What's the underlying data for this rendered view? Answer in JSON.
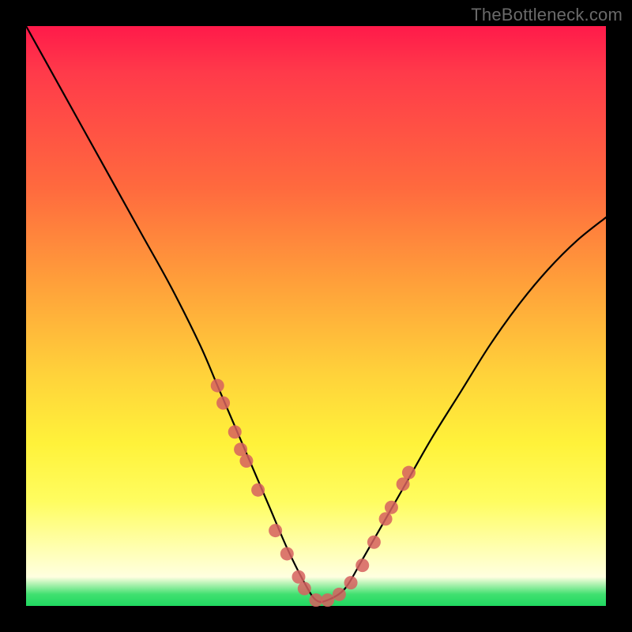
{
  "watermark": "TheBottleneck.com",
  "chart_data": {
    "type": "line",
    "title": "",
    "xlabel": "",
    "ylabel": "",
    "ylim": [
      0,
      100
    ],
    "xlim": [
      0,
      100
    ],
    "series": [
      {
        "name": "bottleneck-curve",
        "x": [
          0,
          5,
          10,
          15,
          20,
          25,
          30,
          33,
          36,
          39,
          42,
          45,
          48,
          50,
          52,
          55,
          58,
          62,
          66,
          70,
          75,
          80,
          85,
          90,
          95,
          100
        ],
        "values": [
          100,
          91,
          82,
          73,
          64,
          55,
          45,
          38,
          31,
          24,
          17,
          10,
          4,
          1,
          1,
          3,
          8,
          15,
          22,
          29,
          37,
          45,
          52,
          58,
          63,
          67
        ]
      }
    ],
    "markers": {
      "name": "highlight-points",
      "color": "#d6605f",
      "points": [
        {
          "x": 33,
          "y": 38
        },
        {
          "x": 34,
          "y": 35
        },
        {
          "x": 36,
          "y": 30
        },
        {
          "x": 37,
          "y": 27
        },
        {
          "x": 38,
          "y": 25
        },
        {
          "x": 40,
          "y": 20
        },
        {
          "x": 43,
          "y": 13
        },
        {
          "x": 45,
          "y": 9
        },
        {
          "x": 47,
          "y": 5
        },
        {
          "x": 48,
          "y": 3
        },
        {
          "x": 50,
          "y": 1
        },
        {
          "x": 52,
          "y": 1
        },
        {
          "x": 54,
          "y": 2
        },
        {
          "x": 56,
          "y": 4
        },
        {
          "x": 58,
          "y": 7
        },
        {
          "x": 60,
          "y": 11
        },
        {
          "x": 62,
          "y": 15
        },
        {
          "x": 63,
          "y": 17
        },
        {
          "x": 65,
          "y": 21
        },
        {
          "x": 66,
          "y": 23
        }
      ]
    },
    "gradient_stops": [
      {
        "pos": 0,
        "color": "#ff1a4a"
      },
      {
        "pos": 45,
        "color": "#ffa23a"
      },
      {
        "pos": 82,
        "color": "#fffd60"
      },
      {
        "pos": 100,
        "color": "#20d860"
      }
    ]
  }
}
